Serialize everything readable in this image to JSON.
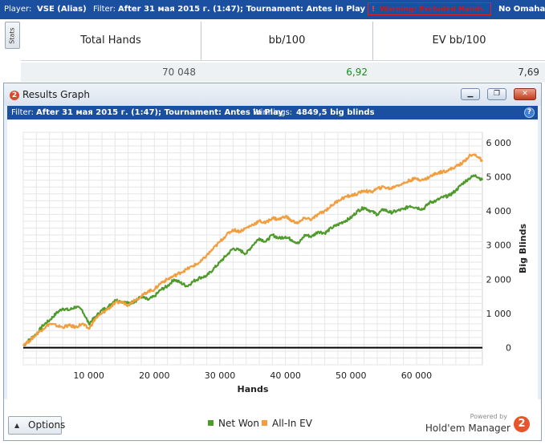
{
  "topbar": {
    "player_label": "Player:",
    "player_value": "VSE (Alias)",
    "filter_label": "Filter:",
    "filter_value": "After 31 мая 2015 г. (1:47); Tournament: Antes in Play",
    "warning_label": "Warning: Excluded Hands",
    "game_value": "No Omaha"
  },
  "stats_tab": {
    "label": "Stats"
  },
  "stats_table": {
    "headers": [
      "Total Hands",
      "bb/100",
      "EV bb/100"
    ],
    "values": [
      "70 048",
      "6,92",
      "7,69"
    ],
    "value_colors": [
      "#555555",
      "#1a8a1a",
      "#333333"
    ]
  },
  "results_window": {
    "title": "Results Graph",
    "logo_label": "2",
    "buttons": {
      "minimize": "▁",
      "restore": "❐",
      "close": "✕"
    },
    "filter": {
      "label": "Filter:",
      "value": "After 31 мая 2015 г. (1:47); Tournament: Antes in Play",
      "winnings_label": "Winnings:",
      "winnings_value": "4849,5 big blinds",
      "help": "?"
    },
    "options_label": "Options",
    "powered_by": "Powered by",
    "brand": "Hold'em Manager",
    "brand_logo": "2"
  },
  "chart_data": {
    "type": "line",
    "xlabel": "Hands",
    "ylabel": "Big Blinds",
    "xlim": [
      0,
      70048
    ],
    "ylim": [
      -500,
      6300
    ],
    "x_ticks": [
      10000,
      20000,
      30000,
      40000,
      50000,
      60000
    ],
    "x_tick_labels": [
      "10 000",
      "20 000",
      "30 000",
      "40 000",
      "50 000",
      "60 000"
    ],
    "y_ticks": [
      0,
      1000,
      2000,
      3000,
      4000,
      5000,
      6000
    ],
    "y_tick_labels": [
      "0",
      "1 000",
      "2 000",
      "3 000",
      "4 000",
      "5 000",
      "6 000"
    ],
    "grid": true,
    "legend_position": "bottom",
    "series": [
      {
        "name": "Net Won",
        "color": "#4e9a2a",
        "x": [
          0,
          1000,
          2000,
          3000,
          4000,
          5000,
          6000,
          7000,
          8000,
          9000,
          10000,
          11000,
          12000,
          13000,
          14000,
          15000,
          16000,
          17000,
          18000,
          19000,
          20000,
          21000,
          22000,
          23000,
          24000,
          25000,
          26000,
          27000,
          28000,
          29000,
          30000,
          31000,
          32000,
          33000,
          34000,
          35000,
          36000,
          37000,
          38000,
          39000,
          40000,
          41000,
          42000,
          43000,
          44000,
          45000,
          46000,
          47000,
          48000,
          49000,
          50000,
          51000,
          52000,
          53000,
          54000,
          55000,
          56000,
          57000,
          58000,
          59000,
          60000,
          61000,
          62000,
          63000,
          64000,
          65000,
          66000,
          67000,
          68000,
          69000,
          70048
        ],
        "y": [
          50,
          250,
          400,
          650,
          800,
          1000,
          1150,
          1100,
          1200,
          1100,
          700,
          900,
          1100,
          1200,
          1400,
          1350,
          1300,
          1350,
          1500,
          1400,
          1500,
          1700,
          1800,
          2000,
          1900,
          1800,
          1950,
          2050,
          2100,
          2300,
          2500,
          2700,
          2900,
          2850,
          2750,
          3000,
          3200,
          3100,
          3300,
          3200,
          3250,
          3150,
          3050,
          3300,
          3250,
          3400,
          3350,
          3500,
          3600,
          3700,
          3800,
          4000,
          4100,
          4000,
          3900,
          4050,
          3950,
          4000,
          4050,
          4150,
          4100,
          4050,
          4250,
          4300,
          4400,
          4450,
          4600,
          4800,
          4950,
          5050,
          4900
        ]
      },
      {
        "name": "All-In EV",
        "color": "#f29d3e",
        "x": [
          0,
          1000,
          2000,
          3000,
          4000,
          5000,
          6000,
          7000,
          8000,
          9000,
          10000,
          11000,
          12000,
          13000,
          14000,
          15000,
          16000,
          17000,
          18000,
          19000,
          20000,
          21000,
          22000,
          23000,
          24000,
          25000,
          26000,
          27000,
          28000,
          29000,
          30000,
          31000,
          32000,
          33000,
          34000,
          35000,
          36000,
          37000,
          38000,
          39000,
          40000,
          41000,
          42000,
          43000,
          44000,
          45000,
          46000,
          47000,
          48000,
          49000,
          50000,
          51000,
          52000,
          53000,
          54000,
          55000,
          56000,
          57000,
          58000,
          59000,
          60000,
          61000,
          62000,
          63000,
          64000,
          65000,
          66000,
          67000,
          68000,
          69000,
          70048
        ],
        "y": [
          100,
          200,
          400,
          550,
          700,
          650,
          600,
          650,
          600,
          700,
          550,
          850,
          1000,
          1150,
          1300,
          1350,
          1250,
          1400,
          1500,
          1650,
          1700,
          1900,
          2000,
          2100,
          2200,
          2300,
          2400,
          2500,
          2700,
          2900,
          3100,
          3300,
          3450,
          3400,
          3500,
          3600,
          3700,
          3650,
          3800,
          3750,
          3850,
          3700,
          3650,
          3800,
          3750,
          3900,
          4000,
          4150,
          4300,
          4400,
          4450,
          4500,
          4600,
          4550,
          4650,
          4700,
          4650,
          4750,
          4800,
          4900,
          4950,
          4900,
          5000,
          5100,
          5150,
          5200,
          5300,
          5400,
          5600,
          5650,
          5450
        ]
      }
    ]
  }
}
